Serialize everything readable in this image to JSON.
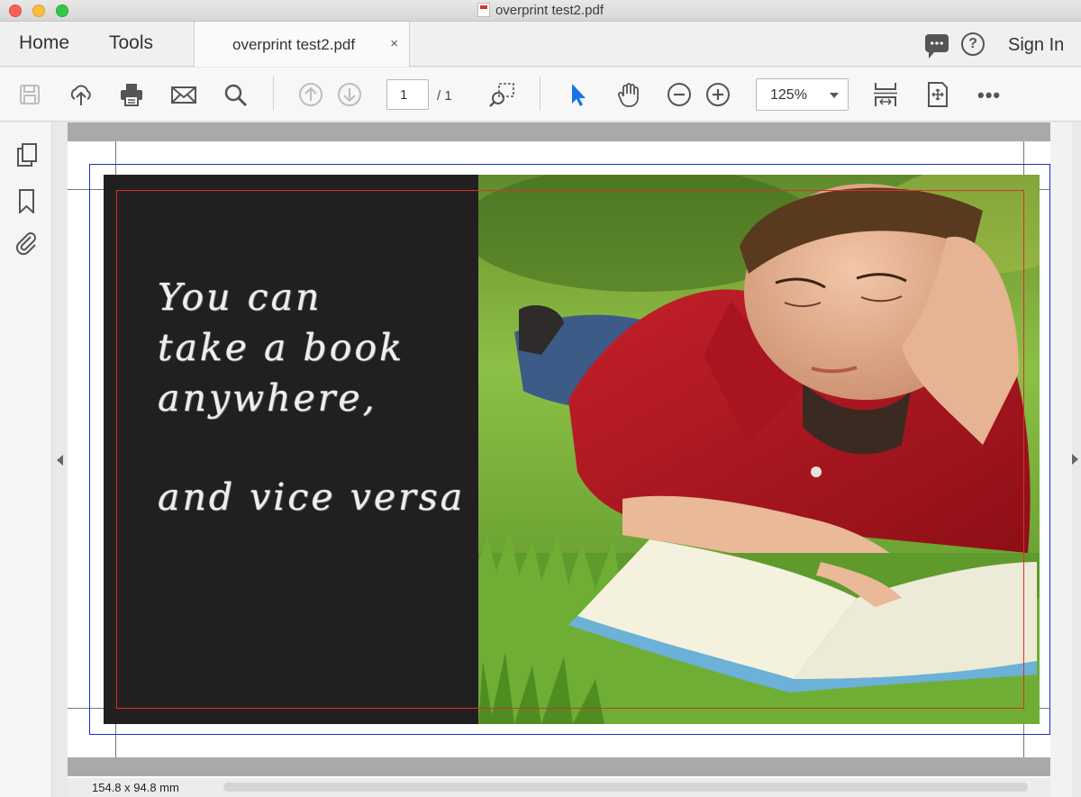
{
  "window": {
    "title": "overprint test2.pdf"
  },
  "tabs": {
    "home": "Home",
    "tools": "Tools",
    "document_tab": "overprint test2.pdf",
    "close_glyph": "×",
    "sign_in": "Sign In"
  },
  "toolbar": {
    "icons": [
      "save-icon",
      "upload-icon",
      "print-icon",
      "email-icon",
      "search-icon",
      "page-up-icon",
      "page-down-icon",
      "marquee-zoom-icon",
      "select-pointer-icon",
      "hand-tool-icon",
      "zoom-out-icon",
      "zoom-in-icon",
      "scroll-mode-icon",
      "fit-page-icon",
      "more-icon"
    ],
    "page_current": "1",
    "page_total": "/ 1",
    "zoom": "125%",
    "more": "•••",
    "help": "?"
  },
  "sidebar": {
    "icons": [
      "pages-icon",
      "bookmark-icon",
      "attachment-icon"
    ]
  },
  "document": {
    "lines": [
      "You can",
      "take a book",
      "anywhere,",
      "and vice versa"
    ],
    "photo_description_icon": "photo-boy-reading"
  },
  "status": {
    "dimensions": "154.8 x 94.8 mm"
  },
  "colors": {
    "dark_panel": "#221f20",
    "bleed_box": "#1a2fc8",
    "trim_box": "#d9312b",
    "accent_blue": "#1473e6"
  }
}
